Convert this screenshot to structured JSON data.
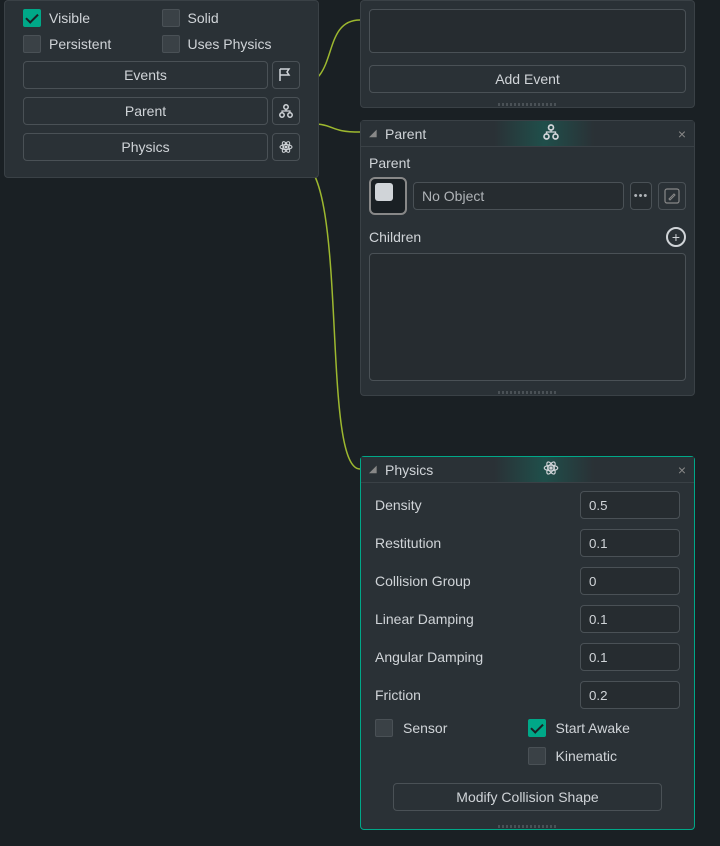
{
  "leftPanel": {
    "checkboxes": {
      "visible": {
        "label": "Visible",
        "checked": true
      },
      "solid": {
        "label": "Solid",
        "checked": false
      },
      "persistent": {
        "label": "Persistent",
        "checked": false
      },
      "usesPhysics": {
        "label": "Uses Physics",
        "checked": false
      }
    },
    "buttons": {
      "events": "Events",
      "parent": "Parent",
      "physics": "Physics"
    }
  },
  "eventsPanel": {
    "addEvent": "Add Event"
  },
  "parentPanel": {
    "title": "Parent",
    "parentLabel": "Parent",
    "objectValue": "No Object",
    "childrenLabel": "Children"
  },
  "physicsPanel": {
    "title": "Physics",
    "props": {
      "density": {
        "label": "Density",
        "value": "0.5"
      },
      "restitution": {
        "label": "Restitution",
        "value": "0.1"
      },
      "collisionGroup": {
        "label": "Collision Group",
        "value": "0"
      },
      "linearDamping": {
        "label": "Linear Damping",
        "value": "0.1"
      },
      "angularDamping": {
        "label": "Angular Damping",
        "value": "0.1"
      },
      "friction": {
        "label": "Friction",
        "value": "0.2"
      }
    },
    "checks": {
      "sensor": {
        "label": "Sensor",
        "checked": false
      },
      "startAwake": {
        "label": "Start Awake",
        "checked": true
      },
      "kinematic": {
        "label": "Kinematic",
        "checked": false
      }
    },
    "modifyButton": "Modify Collision Shape"
  }
}
